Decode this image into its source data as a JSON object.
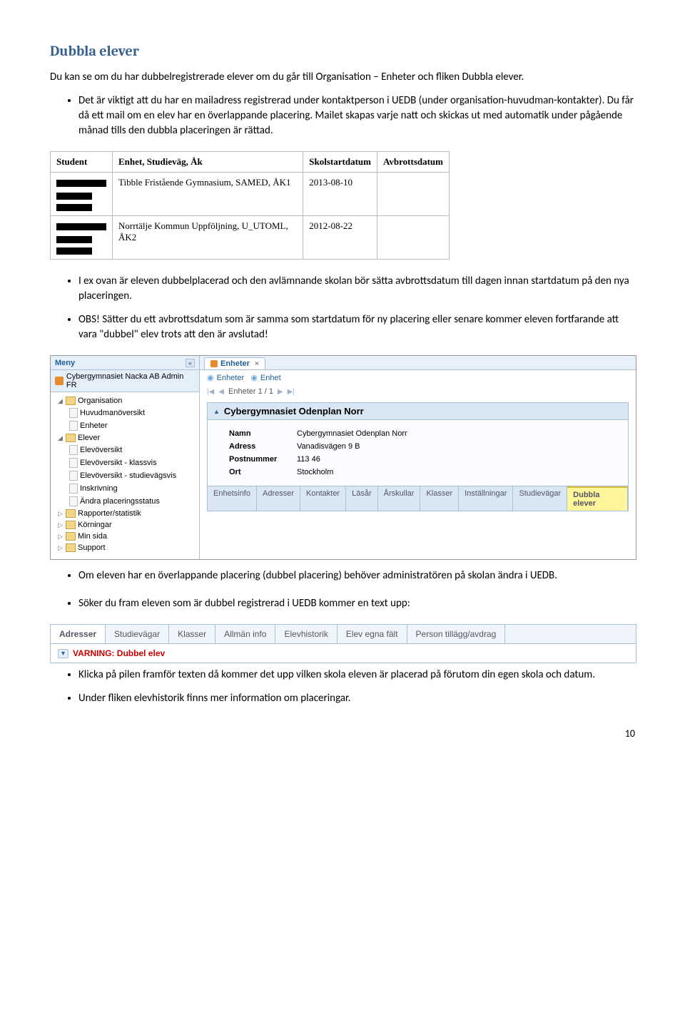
{
  "title": "Dubbla elever",
  "intro": "Du kan se om du har dubbelregistrerade elever om du går till Organisation – Enheter och fliken Dubbla elever.",
  "bullet1": "Det är viktigt att du har en mailadress registrerad under kontaktperson i UEDB (under organisation-huvudman-kontakter). Du får då ett mail om en elev har en överlappande placering. Mailet skapas varje natt och skickas ut med automatik under pågående månad tills den dubbla placeringen är rättad.",
  "table1": {
    "headers": [
      "Student",
      "Enhet, Studieväg, Åk",
      "Skolstartdatum",
      "Avbrottsdatum"
    ],
    "rows": [
      {
        "enhet": "Tibble Fristående Gymnasium, SAMED, ÅK1",
        "start": "2013-08-10",
        "stop": ""
      },
      {
        "enhet": "Norrtälje Kommun Uppföljning, U_UTOML, ÅK2",
        "start": "2012-08-22",
        "stop": ""
      }
    ]
  },
  "bullet2": "I ex ovan är eleven dubbelplacerad och den avlämnande skolan bör sätta avbrottsdatum till dagen innan startdatum på den nya placeringen.",
  "bullet3": "OBS! Sätter du ett avbrottsdatum som är samma som startdatum för ny placering eller senare kommer eleven fortfarande att vara \"dubbel\" elev trots att den är avslutad!",
  "app": {
    "menu_label": "Meny",
    "sidebar_top": "Cybergymnasiet Nacka AB Admin FR",
    "tree": {
      "organisation": "Organisation",
      "huvudman": "Huvudmanöversikt",
      "enheter": "Enheter",
      "elever": "Elever",
      "elevoversikt": "Elevöversikt",
      "elevoversikt_klass": "Elevöversikt - klassvis",
      "elevoversikt_stud": "Elevöversikt - studievägsvis",
      "inskrivning": "Inskrivning",
      "andra": "Ändra placeringsstatus",
      "rapporter": "Rapporter/statistik",
      "korningar": "Körningar",
      "minsida": "Min sida",
      "support": "Support"
    },
    "tab": "Enheter",
    "crumb1": "Enheter",
    "crumb2": "Enhet",
    "pager_label": "Enheter 1 / 1",
    "panel_title": "Cybergymnasiet Odenplan Norr",
    "kv": {
      "namn_k": "Namn",
      "namn_v": "Cybergymnasiet Odenplan Norr",
      "adress_k": "Adress",
      "adress_v": "Vanadisvägen 9 B",
      "post_k": "Postnummer",
      "post_v": "113 46",
      "ort_k": "Ort",
      "ort_v": "Stockholm"
    },
    "tabs2": [
      "Enhetsinfo",
      "Adresser",
      "Kontakter",
      "Läsår",
      "Årskullar",
      "Klasser",
      "Inställningar",
      "Studievägar",
      "Dubbla elever"
    ]
  },
  "bullet4": "Om eleven har en överlappande placering (dubbel placering) behöver administratören på skolan ändra i UEDB.",
  "bullet5": "Söker du fram eleven som är dubbel registrerad i UEDB kommer en text upp:",
  "tabs3": [
    "Adresser",
    "Studievägar",
    "Klasser",
    "Allmän info",
    "Elevhistorik",
    "Elev egna fält",
    "Person tillägg/avdrag"
  ],
  "warning": "VARNING: Dubbel elev",
  "bullet6": "Klicka på pilen framför texten då kommer det upp vilken skola eleven är placerad på förutom din egen skola och datum.",
  "bullet7": "Under fliken elevhistorik finns mer information om placeringar.",
  "pagenum": "10"
}
